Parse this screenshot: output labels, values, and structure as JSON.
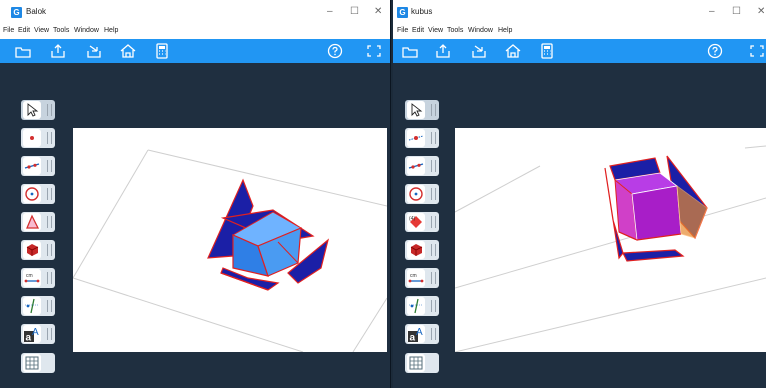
{
  "windows": [
    {
      "title": "Balok",
      "menu": [
        "File",
        "Edit",
        "View",
        "Tools",
        "Window",
        "Help"
      ],
      "toolbar_icons": [
        "open-file-icon",
        "export-icon",
        "share-icon",
        "home-icon",
        "calculator-icon",
        "help-icon",
        "fullscreen-icon"
      ],
      "tools": [
        "move",
        "point",
        "line",
        "circle",
        "polygon",
        "solid",
        "distance",
        "perpendicular-line",
        "text",
        "table"
      ],
      "solid_colors": {
        "faces": "#1b1fa6",
        "box": "#4a9bf2",
        "edges": "#e02020"
      }
    },
    {
      "title": "kubus",
      "menu": [
        "File",
        "Edit",
        "View",
        "Tools",
        "Window",
        "Help"
      ],
      "toolbar_icons": [
        "open-file-icon",
        "export-icon",
        "share-icon",
        "home-icon",
        "calculator-icon",
        "help-icon",
        "fullscreen-icon"
      ],
      "tools": [
        "move",
        "point",
        "line",
        "circle",
        "polygon",
        "solid",
        "distance",
        "perpendicular-line",
        "text",
        "table"
      ],
      "solid_colors": {
        "faces": "#1b1fa6",
        "box": "#c01ec8",
        "edges": "#e02020"
      }
    }
  ],
  "window_controls": {
    "minimize": "–",
    "maximize": "☐",
    "close": "✕"
  },
  "colors": {
    "toolbar": "#2196f3",
    "app_bg": "#1f2f40",
    "canvas": "#ffffff"
  }
}
